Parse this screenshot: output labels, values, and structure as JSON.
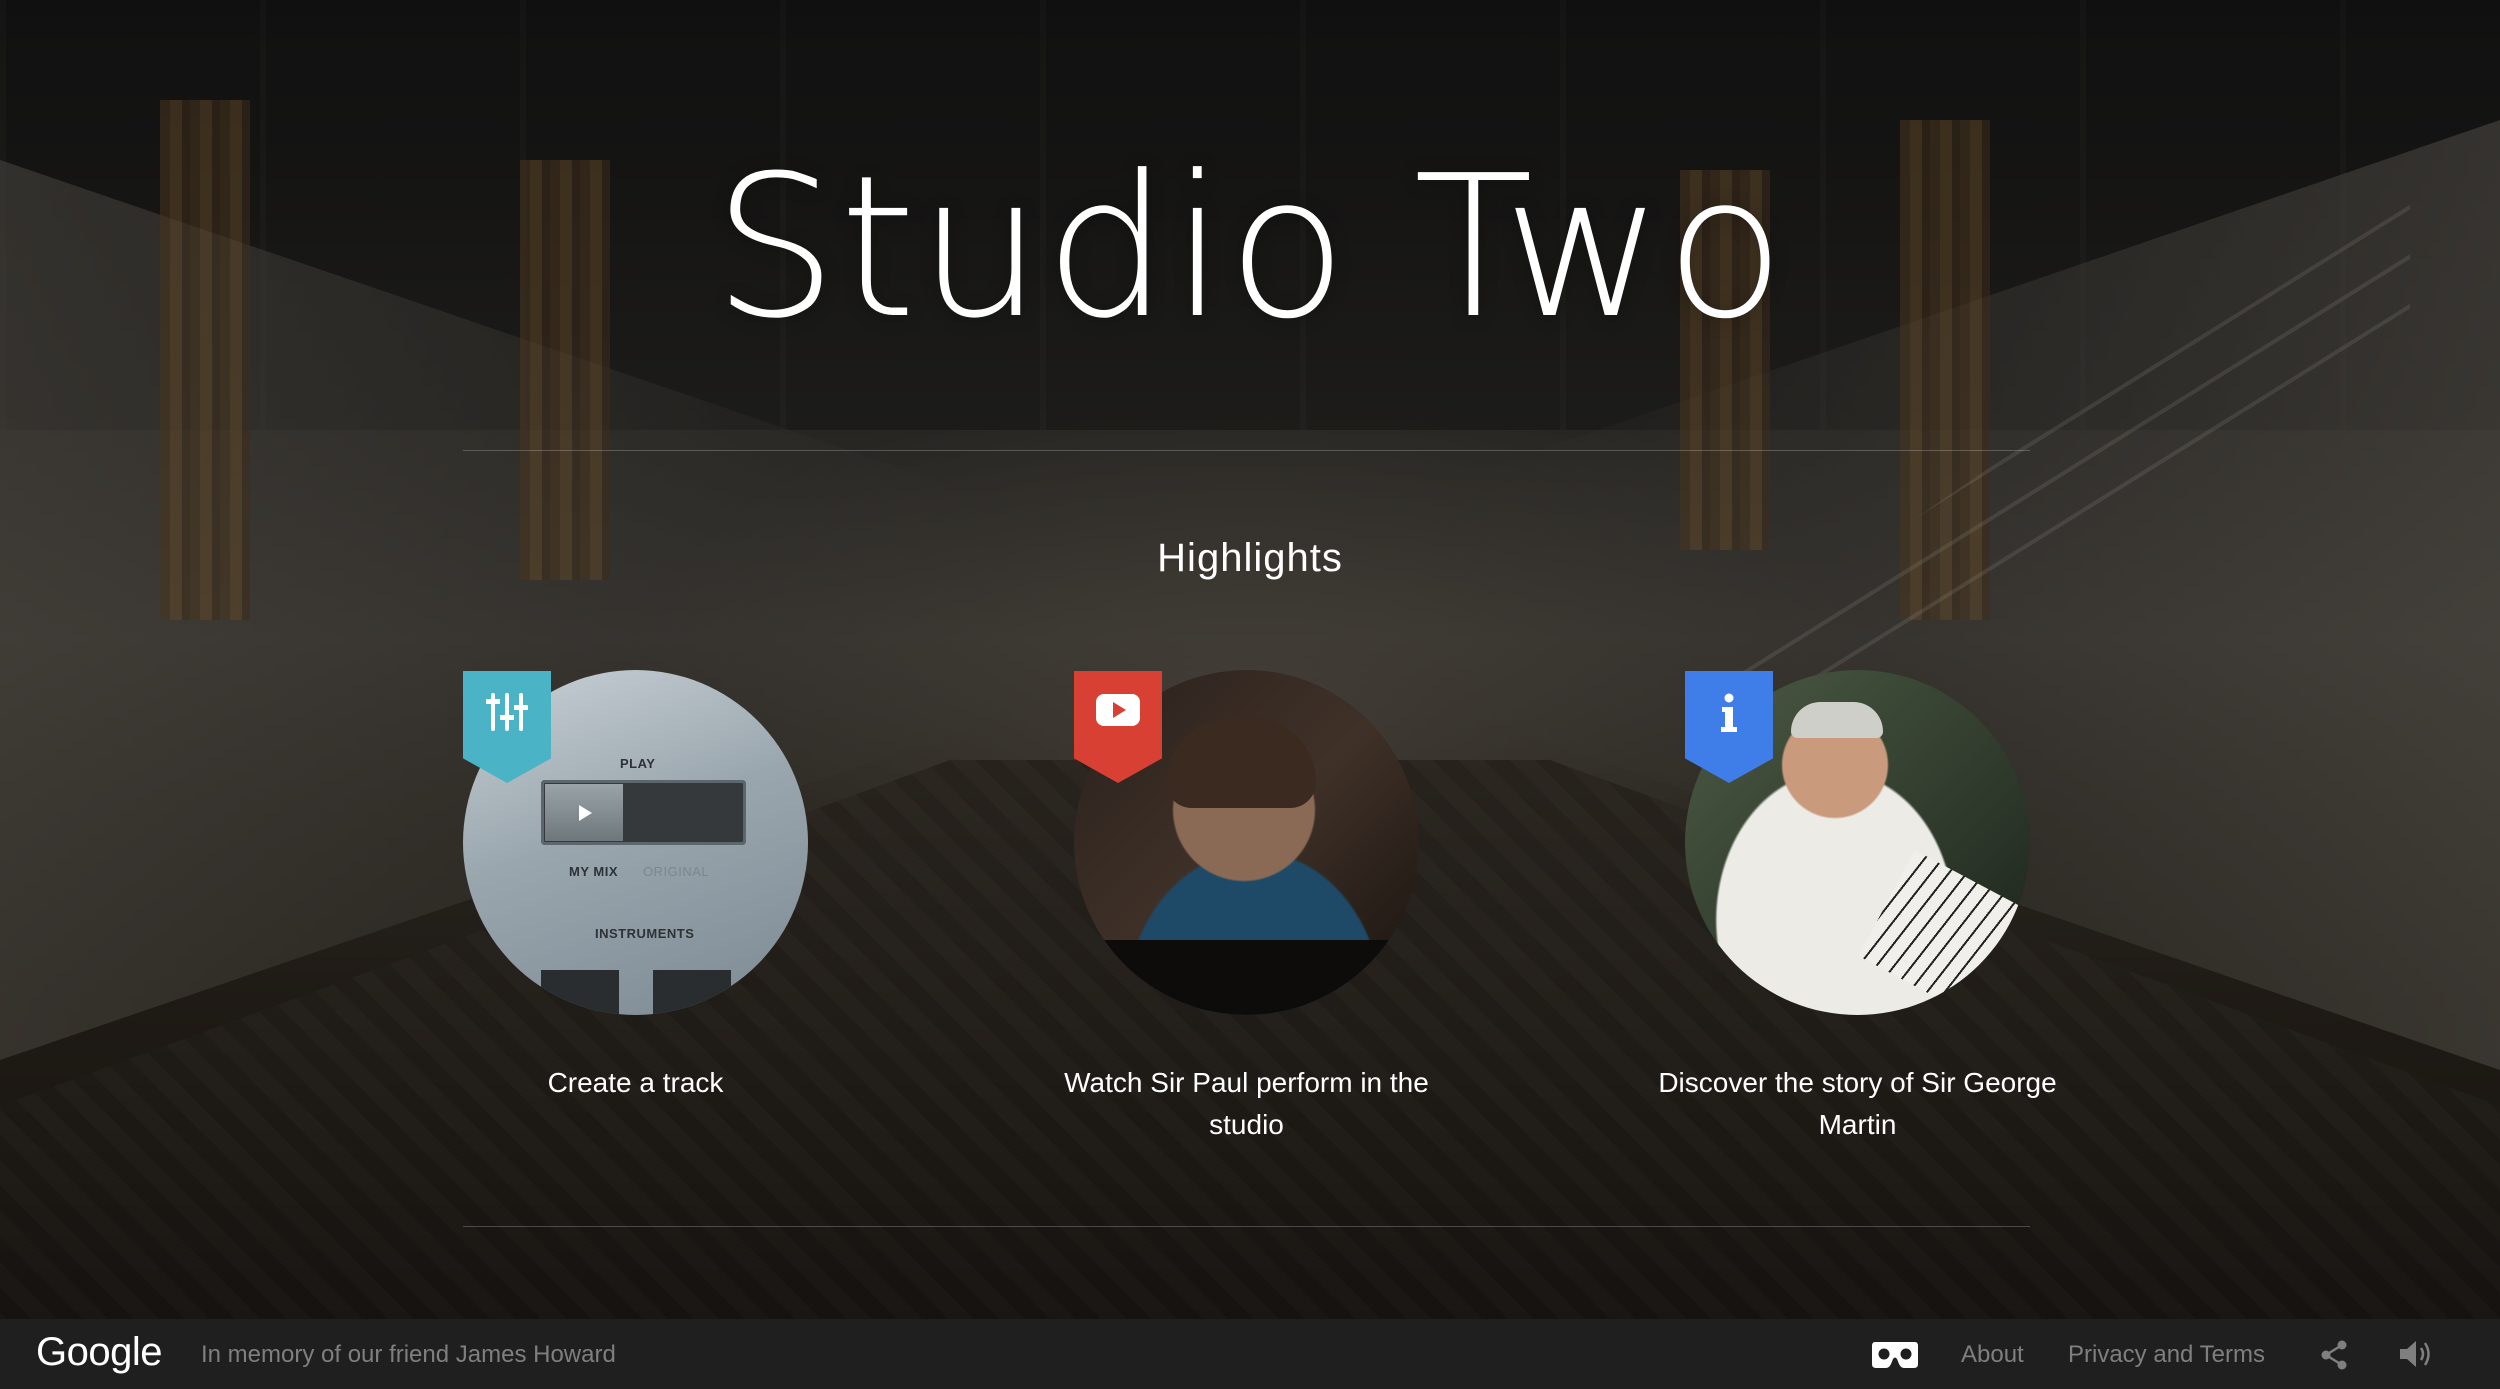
{
  "page": {
    "title": "Studio Two",
    "section_heading": "Highlights"
  },
  "highlights": [
    {
      "caption": "Create a track",
      "badge_icon": "mixer-sliders-icon",
      "badge_color": "#4ab3c5",
      "thumbnail_text": {
        "play": "PLAY",
        "my_mix": "MY MIX",
        "original": "ORIGINAL",
        "instruments": "INSTRUMENTS"
      }
    },
    {
      "caption": "Watch Sir Paul perform in the studio",
      "badge_icon": "youtube-play-icon",
      "badge_color": "#d84034"
    },
    {
      "caption": "Discover the story of Sir George Martin",
      "badge_icon": "info-icon",
      "badge_color": "#3f7de8"
    }
  ],
  "footer": {
    "logo": "Google",
    "memory_text": "In memory of our friend James Howard",
    "vr_icon": "cardboard-vr-icon",
    "about_label": "About",
    "privacy_label": "Privacy and Terms",
    "share_icon": "share-icon",
    "sound_icon": "volume-icon"
  }
}
